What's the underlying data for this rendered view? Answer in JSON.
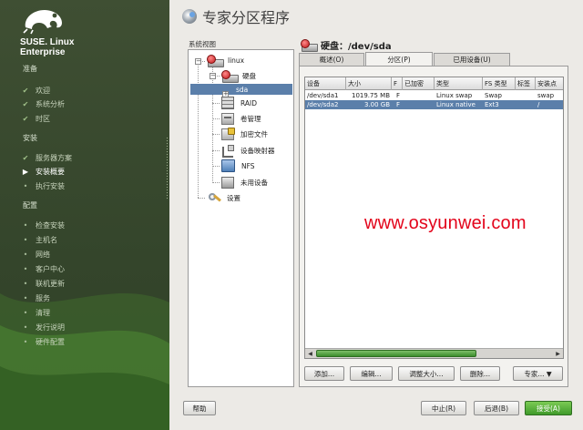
{
  "sidebar": {
    "brand": [
      "SUSE. Linux",
      "Enterprise"
    ],
    "sections": [
      {
        "title": "准备",
        "steps": [
          {
            "label": "欢迎",
            "state": "done"
          },
          {
            "label": "系统分析",
            "state": "done"
          },
          {
            "label": "时区",
            "state": "done"
          }
        ]
      },
      {
        "title": "安装",
        "steps": [
          {
            "label": "服务器方案",
            "state": "done"
          },
          {
            "label": "安装概要",
            "state": "current"
          },
          {
            "label": "执行安装",
            "state": "todo"
          }
        ]
      },
      {
        "title": "配置",
        "steps": [
          {
            "label": "检查安装",
            "state": "todo"
          },
          {
            "label": "主机名",
            "state": "todo"
          },
          {
            "label": "网络",
            "state": "todo"
          },
          {
            "label": "客户中心",
            "state": "todo"
          },
          {
            "label": "联机更新",
            "state": "todo"
          },
          {
            "label": "服务",
            "state": "todo"
          },
          {
            "label": "清理",
            "state": "todo"
          },
          {
            "label": "发行说明",
            "state": "todo"
          },
          {
            "label": "硬件配置",
            "state": "todo"
          }
        ]
      }
    ]
  },
  "header": {
    "title": "专家分区程序"
  },
  "tree": {
    "label": "系统视图",
    "nodes": {
      "linux": "linux",
      "harddisk": "硬盘",
      "sda": "sda",
      "raid": "RAID",
      "volume": "卷管理",
      "crypt": "加密文件",
      "devmapper": "设备映射器",
      "nfs": "NFS",
      "unused": "未用设备",
      "settings": "设置"
    }
  },
  "disk": {
    "title": "硬盘：/dev/sda"
  },
  "tabs": [
    "概述(O)",
    "分区(P)",
    "已用设备(U)"
  ],
  "table": {
    "columns": [
      "设备",
      "大小",
      "F",
      "已加密",
      "类型",
      "FS 类型",
      "标签",
      "安装点"
    ],
    "rows": [
      [
        "/dev/sda1",
        "1019.75 MB",
        "F",
        "",
        "Linux swap",
        "Swap",
        "",
        "swap"
      ],
      [
        "/dev/sda2",
        "3.00 GB",
        "F",
        "",
        "Linux native",
        "Ext3",
        "",
        "/"
      ]
    ],
    "selected_row": 1
  },
  "buttons": {
    "add": "添加...",
    "edit": "编辑...",
    "resize": "调整大小...",
    "delete": "删除...",
    "expert": "专家... ▼",
    "help": "帮助",
    "abort": "中止(R)",
    "back": "后退(B)",
    "accept": "接受(A)"
  },
  "watermark": "www.osyunwei.com"
}
